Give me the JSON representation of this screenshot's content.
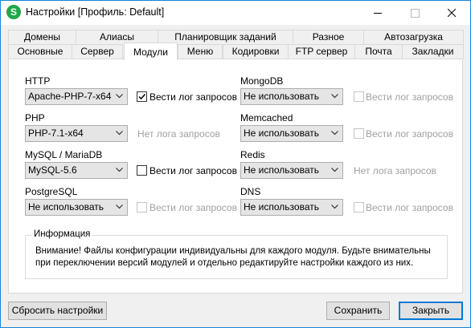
{
  "window": {
    "title": "Настройки [Профиль: Default]",
    "app_icon_letter": "S",
    "accent_color": "#1fa84a"
  },
  "tabs_top": [
    "Домены",
    "Алиасы",
    "Планировщик заданий",
    "Разное",
    "Автозагрузка"
  ],
  "tabs_bottom": [
    "Основные",
    "Сервер",
    "Модули",
    "Меню",
    "Кодировки",
    "FTP сервер",
    "Почта",
    "Закладки"
  ],
  "active_tab": "Модули",
  "modules": {
    "http": {
      "label": "HTTP",
      "value": "Apache-PHP-7-x64",
      "log_label": "Вести лог запросов",
      "log_checked": true
    },
    "php": {
      "label": "PHP",
      "value": "PHP-7.1-x64",
      "no_log_text": "Нет лога запросов"
    },
    "mysql": {
      "label": "MySQL / MariaDB",
      "value": "MySQL-5.6",
      "log_label": "Вести лог запросов",
      "log_checked": false
    },
    "postgresql": {
      "label": "PostgreSQL",
      "value": "Не использовать",
      "log_label": "Вести лог запросов",
      "log_checked": false
    },
    "mongodb": {
      "label": "MongoDB",
      "value": "Не использовать",
      "log_label": "Вести лог запросов",
      "log_checked": false
    },
    "memcached": {
      "label": "Memcached",
      "value": "Не использовать",
      "log_label": "Вести лог запросов",
      "log_checked": false
    },
    "redis": {
      "label": "Redis",
      "value": "Не использовать",
      "no_log_text": "Нет лога запросов"
    },
    "dns": {
      "label": "DNS",
      "value": "Не использовать",
      "log_label": "Вести лог запросов",
      "log_checked": false
    }
  },
  "info": {
    "title": "Информация",
    "text": "Внимание! Файлы конфигурации индивидуальны для каждого модуля. Будьте внимательны при переключении версий модулей и отдельно редактируйте настройки каждого из них."
  },
  "buttons": {
    "reset": "Сбросить настройки",
    "save": "Сохранить",
    "close": "Закрыть"
  }
}
